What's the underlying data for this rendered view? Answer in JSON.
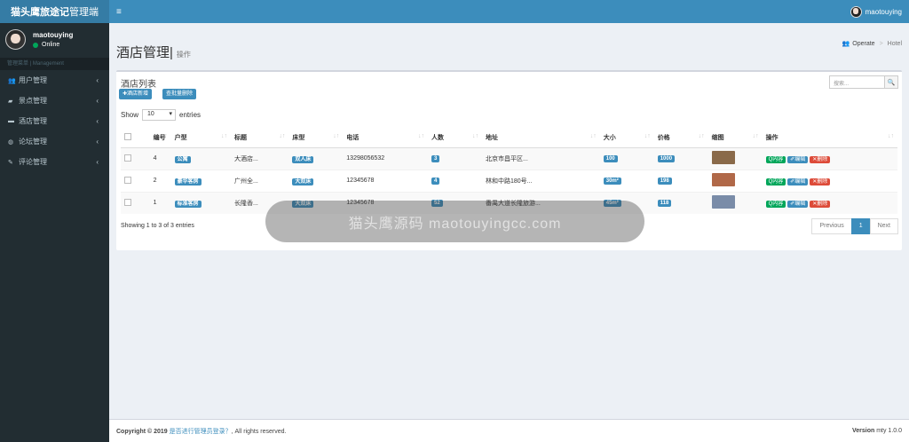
{
  "header": {
    "logo_bold": "猫头鹰旅途记",
    "logo_rest": "管理端",
    "hamburger": "≡",
    "username": "maotouying"
  },
  "sidebar": {
    "user": {
      "name": "maotouying",
      "status": "Online"
    },
    "section_label": "管理菜单 | Management",
    "items": [
      {
        "label": "用户管理",
        "icon": "users-icon",
        "glyph": "👥"
      },
      {
        "label": "景点管理",
        "icon": "book-icon",
        "glyph": "▰"
      },
      {
        "label": "酒店管理",
        "icon": "bed-icon",
        "glyph": "▬"
      },
      {
        "label": "论坛管理",
        "icon": "comments-icon",
        "glyph": "◍"
      },
      {
        "label": "评论管理",
        "icon": "edit-icon",
        "glyph": "✎"
      }
    ],
    "chevron": "‹"
  },
  "page": {
    "title": "酒店管理",
    "subtitle": "操作",
    "breadcrumb": [
      "Operate",
      "Hotel"
    ]
  },
  "box": {
    "title": "酒店列表",
    "search_placeholder": "搜索...",
    "add_button": "✚酒店新增",
    "batch_delete_button": "查批量删除",
    "show_label": "Show",
    "show_value": "10",
    "entries_label": "entries",
    "columns": [
      "",
      "编号",
      "户型",
      "标题",
      "床型",
      "电话",
      "人数",
      "地址",
      "大小",
      "价格",
      "缩图",
      "操作"
    ],
    "rows": [
      {
        "id": "4",
        "type": "公寓",
        "title": "大酒店...",
        "bed": "双人床",
        "phone": "13298056532",
        "people": "3",
        "address": "北京市昌平区...",
        "size": "100",
        "price": "1000",
        "thumb_color": "#8a6a4a"
      },
      {
        "id": "2",
        "type": "豪华客房",
        "title": "广州全...",
        "bed": "大双床",
        "phone": "12345678",
        "people": "4",
        "address": "林和中路180号...",
        "size": "30m²",
        "price": "198",
        "thumb_color": "#b06848"
      },
      {
        "id": "1",
        "type": "标准客房",
        "title": "长隆香...",
        "bed": "大双床",
        "phone": "12345678",
        "people": "52",
        "address": "番禺大道长隆旅游...",
        "size": "45m²",
        "price": "118",
        "thumb_color": "#7a8ca8"
      }
    ],
    "actions": {
      "view": "Q内容",
      "edit": "✐编辑",
      "delete": "✕删除"
    },
    "showing": "Showing 1 to 3 of 3 entries",
    "pagination": {
      "prev": "Previous",
      "current": "1",
      "next": "Next"
    }
  },
  "footer": {
    "copyright": "Copyright © 2019",
    "link": "是否进行管理员登录？",
    "rights": ", All rights reserved.",
    "version_label": "Version",
    "version_value": "mty 1.0.0"
  },
  "watermark": "猫头鹰源码 maotouyingcc.com",
  "colors": {
    "primary": "#3c8dbc",
    "sidebar": "#222d32",
    "success": "#00a65a",
    "danger": "#dd4b39"
  }
}
